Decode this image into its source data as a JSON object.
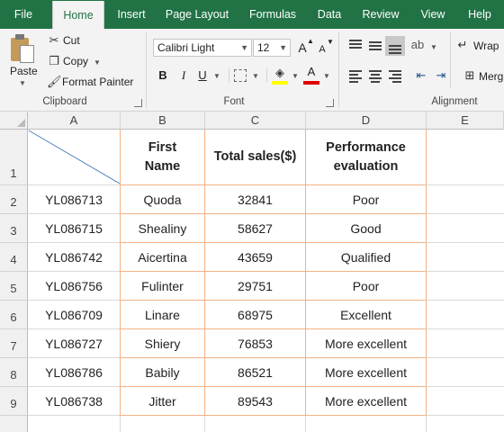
{
  "tabs": [
    "File",
    "Home",
    "Insert",
    "Page Layout",
    "Formulas",
    "Data",
    "Review",
    "View",
    "Help"
  ],
  "clipboard": {
    "paste": "Paste",
    "cut": "Cut",
    "copy": "Copy",
    "format_painter": "Format Painter",
    "group_label": "Clipboard"
  },
  "font": {
    "name": "Calibri Light",
    "size": "12",
    "bold": "B",
    "italic": "I",
    "underline": "U",
    "grow": "A",
    "shrink": "A",
    "font_color": "A",
    "group_label": "Font"
  },
  "alignment": {
    "wrap": "Wrap",
    "merge": "Merg",
    "group_label": "Alignment"
  },
  "columns": [
    "A",
    "B",
    "C",
    "D",
    "E"
  ],
  "row_numbers": [
    "1",
    "2",
    "3",
    "4",
    "5",
    "6",
    "7",
    "8",
    "9"
  ],
  "header": {
    "first_name_1": "First",
    "first_name_2": "Name",
    "total_sales": "Total sales($)",
    "perf_1": "Performance",
    "perf_2": "evaluation"
  },
  "rows": [
    {
      "id": "YL086713",
      "name": "Quoda",
      "sales": "32841",
      "eval": "Poor"
    },
    {
      "id": "YL086715",
      "name": "Shealiny",
      "sales": "58627",
      "eval": "Good"
    },
    {
      "id": "YL086742",
      "name": "Aicertina",
      "sales": "43659",
      "eval": "Qualified"
    },
    {
      "id": "YL086756",
      "name": "Fulinter",
      "sales": "29751",
      "eval": "Poor"
    },
    {
      "id": "YL086709",
      "name": "Linare",
      "sales": "68975",
      "eval": "Excellent"
    },
    {
      "id": "YL086727",
      "name": "Shiery",
      "sales": "76853",
      "eval": "More excellent"
    },
    {
      "id": "YL086786",
      "name": "Babily",
      "sales": "86521",
      "eval": "More excellent"
    },
    {
      "id": "YL086738",
      "name": "Jitter",
      "sales": "89543",
      "eval": "More excellent"
    }
  ],
  "colors": {
    "ribbon_green": "#217346",
    "table_border": "#f4b183",
    "font_color_bar": "#e00000",
    "fill_color_bar": "#ffff00"
  }
}
